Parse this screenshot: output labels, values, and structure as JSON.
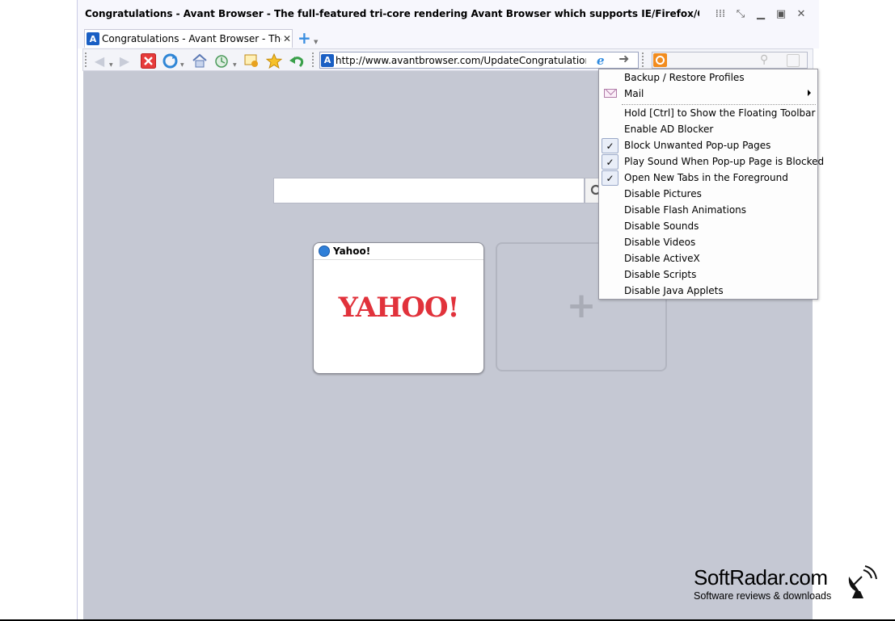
{
  "window": {
    "title": "Congratulations - Avant Browser - The full-featured tri-core rendering Avant Browser which supports IE/Firefox/Chrome engines is ...",
    "controls": [
      "grid-icon",
      "collapse-icon",
      "minimize-icon",
      "maximize-icon",
      "close-icon"
    ]
  },
  "tabs": [
    {
      "label": "Congratulations - Avant Browser - The...",
      "icon": "A",
      "active": true
    }
  ],
  "toolbar": {
    "address": "http://www.avantbrowser.com/UpdateCongratulations.aspx",
    "engine_badge": "e"
  },
  "page": {
    "tiles": [
      {
        "title": "Yahoo!",
        "logo_text": "YAHOO!"
      }
    ],
    "add_tile_symbol": "+"
  },
  "menu": {
    "items": [
      {
        "label": "Backup / Restore Profiles",
        "checked": false
      },
      {
        "label": "Mail",
        "icon": "mail-icon",
        "submenu": true,
        "checked": false
      },
      {
        "label": "Hold [Ctrl] to Show the Floating Toolbar",
        "checked": false
      },
      {
        "label": "Enable AD Blocker",
        "checked": false
      },
      {
        "label": "Block Unwanted Pop-up Pages",
        "checked": true
      },
      {
        "label": "Play Sound When Pop-up Page is Blocked",
        "checked": true
      },
      {
        "label": "Open New Tabs in the Foreground",
        "checked": true
      },
      {
        "label": "Disable Pictures",
        "checked": false
      },
      {
        "label": "Disable Flash Animations",
        "checked": false
      },
      {
        "label": "Disable Sounds",
        "checked": false
      },
      {
        "label": "Disable Videos",
        "checked": false
      },
      {
        "label": "Disable ActiveX",
        "checked": false
      },
      {
        "label": "Disable Scripts",
        "checked": false
      },
      {
        "label": "Disable Java Applets",
        "checked": false
      }
    ],
    "check_glyph": "✓"
  },
  "watermark": {
    "name": "SoftRadar.com",
    "tagline": "Software reviews & downloads"
  }
}
